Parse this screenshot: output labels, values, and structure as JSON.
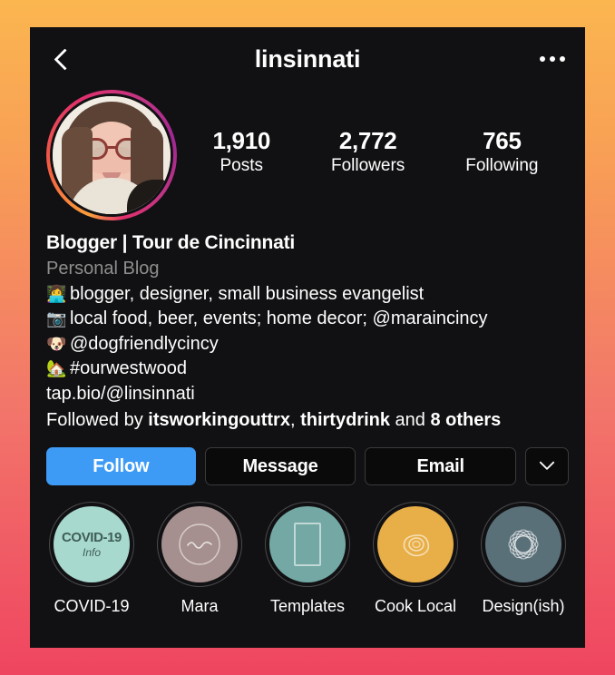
{
  "header": {
    "back_icon": "back-chevron-icon",
    "title": "linsinnati",
    "menu_icon": "more-options-icon"
  },
  "profile": {
    "avatar_alt": "profile-photo",
    "stats": [
      {
        "value": "1,910",
        "label": "Posts"
      },
      {
        "value": "2,772",
        "label": "Followers"
      },
      {
        "value": "765",
        "label": "Following"
      }
    ]
  },
  "bio": {
    "name": "Blogger | Tour de Cincinnati",
    "category": "Personal Blog",
    "lines": [
      {
        "emoji": "👩‍💻",
        "text": "blogger, designer, small business evangelist"
      },
      {
        "emoji": "📷",
        "text": "local food, beer, events; home decor; @maraincincy"
      },
      {
        "emoji": "🐶",
        "text": "@dogfriendlycincy"
      },
      {
        "emoji": "🏡",
        "text": "#ourwestwood"
      }
    ],
    "link": "tap.bio/@linsinnati",
    "followed_by": {
      "prefix": "Followed by ",
      "user1": "itsworkingouttrx",
      "separator": ", ",
      "user2": "thirtydrink",
      "conjunction": " and ",
      "others": "8 others"
    }
  },
  "actions": {
    "follow": "Follow",
    "message": "Message",
    "email": "Email",
    "more_icon": "chevron-down-icon",
    "follow_color": "#3E9BF5"
  },
  "highlights": [
    {
      "label": "COVID-19",
      "color": "#A8D9CF",
      "icon": "covid-info-cover",
      "cover_title": "COVID-19",
      "cover_sub": "Info"
    },
    {
      "label": "Mara",
      "color": "#A6908F",
      "icon": "wave-monogram-icon"
    },
    {
      "label": "Templates",
      "color": "#73A8A4",
      "icon": "rectangle-frame-icon"
    },
    {
      "label": "Cook Local",
      "color": "#E8AE47",
      "icon": "fried-egg-icon"
    },
    {
      "label": "Design(ish)",
      "color": "#5A7079",
      "icon": "spirograph-icon"
    }
  ],
  "theme": {
    "background": "#111113",
    "border_gradient_top": "#FBB650",
    "border_gradient_bottom": "#EF4560",
    "text_primary": "#FFFFFF",
    "text_muted": "#8E8E8E"
  }
}
